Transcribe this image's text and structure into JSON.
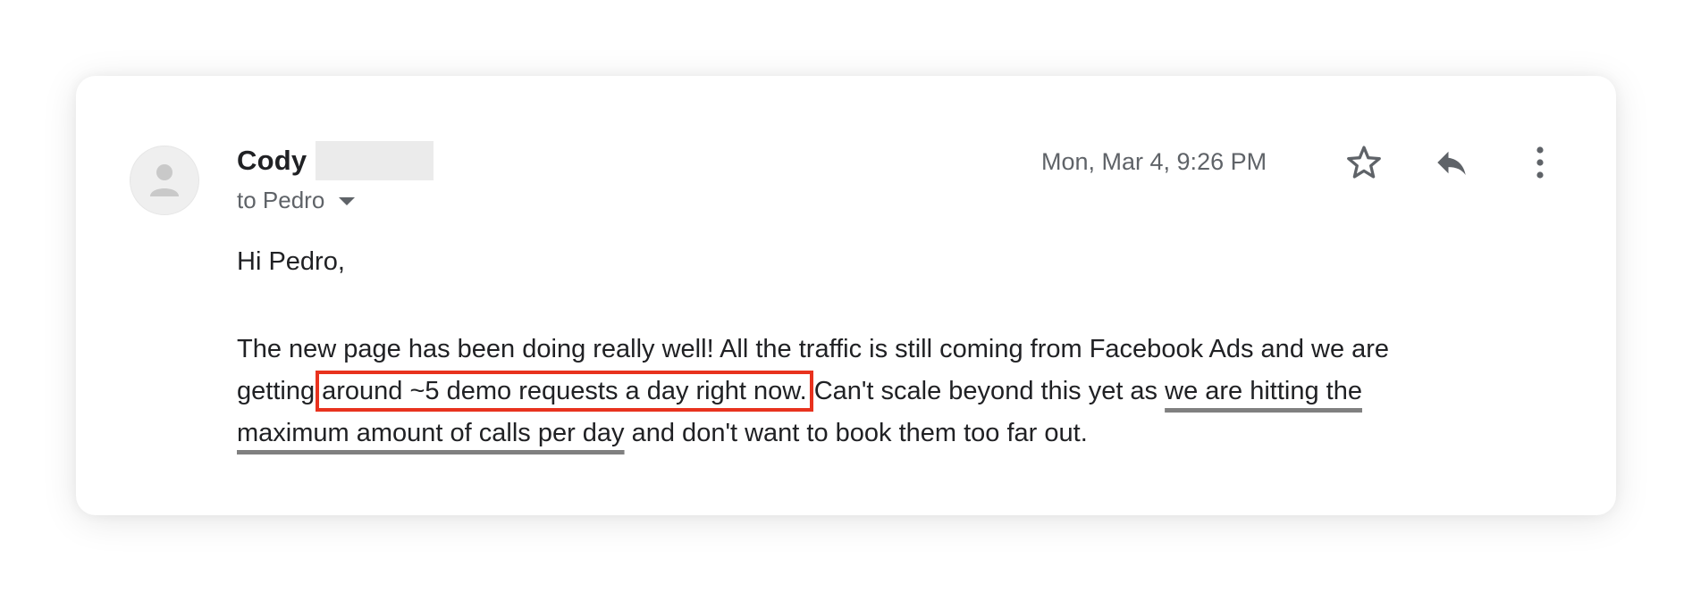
{
  "sender": {
    "name": "Cody"
  },
  "recipient": {
    "label": "to Pedro"
  },
  "timestamp": "Mon, Mar 4, 9:26 PM",
  "actions": {
    "star_icon": "star-icon",
    "reply_icon": "reply-icon",
    "more_icon": "more-vertical-icon"
  },
  "message": {
    "greeting": "Hi Pedro,",
    "line1": "The new page has been doing really well! All the traffic is still coming from Facebook Ads and we are",
    "line2_start": "getting ",
    "line2_highlight": "around ~5 demo requests a day right now.",
    "line2_middle": " Can't scale beyond this yet as ",
    "line2_underline": "we are hitting the",
    "line3_underline": "maximum amount of calls per day",
    "line3_end": " and don't want to book them too far out."
  },
  "colors": {
    "highlight_box": "#e8321e",
    "underline": "#808080",
    "text": "#202124",
    "secondary_text": "#5f6368"
  }
}
